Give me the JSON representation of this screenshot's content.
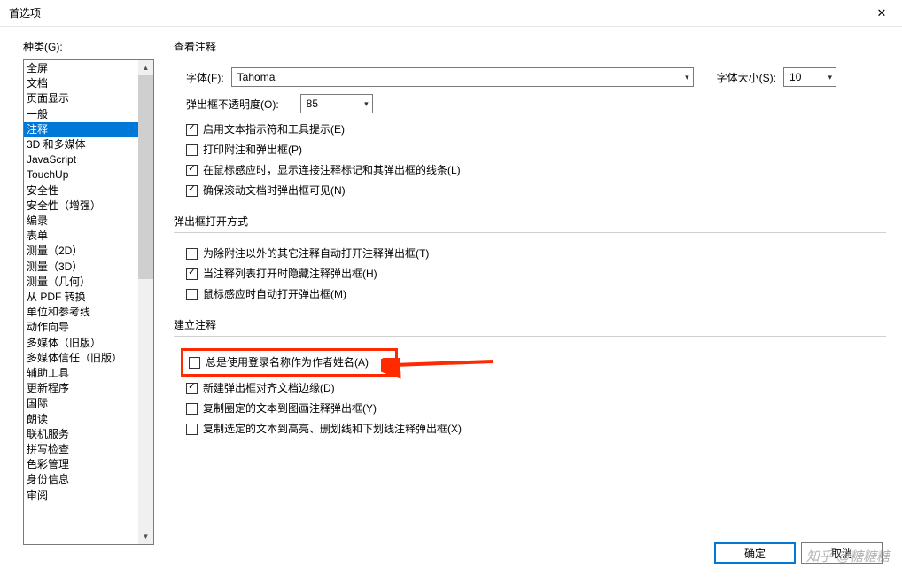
{
  "window": {
    "title": "首选项"
  },
  "leftLabel": "种类(G):",
  "categories": [
    "全屏",
    "文档",
    "页面显示",
    "一般",
    "注释",
    "",
    "3D 和多媒体",
    "JavaScript",
    "TouchUp",
    "安全性",
    "安全性（增强）",
    "编录",
    "表单",
    "测量（2D）",
    "测量（3D）",
    "测量（几何）",
    "从 PDF 转换",
    "单位和参考线",
    "动作向导",
    "多媒体（旧版）",
    "多媒体信任（旧版）",
    "辅助工具",
    "更新程序",
    "国际",
    "朗读",
    "联机服务",
    "拼写检查",
    "色彩管理",
    "身份信息",
    "审阅"
  ],
  "selectedIndex": 4,
  "group1": {
    "title": "查看注释",
    "fontLabel": "字体(F):",
    "fontValue": "Tahoma",
    "sizeLabel": "字体大小(S):",
    "sizeValue": "10",
    "opacityLabel": "弹出框不透明度(O):",
    "opacityValue": "85",
    "checks": [
      {
        "checked": true,
        "label": "启用文本指示符和工具提示(E)"
      },
      {
        "checked": false,
        "label": "打印附注和弹出框(P)"
      },
      {
        "checked": true,
        "label": "在鼠标感应时，显示连接注释标记和其弹出框的线条(L)"
      },
      {
        "checked": true,
        "label": "确保滚动文档时弹出框可见(N)"
      }
    ]
  },
  "group2": {
    "title": "弹出框打开方式",
    "checks": [
      {
        "checked": false,
        "label": "为除附注以外的其它注释自动打开注释弹出框(T)"
      },
      {
        "checked": true,
        "label": "当注释列表打开时隐藏注释弹出框(H)"
      },
      {
        "checked": false,
        "label": "鼠标感应时自动打开弹出框(M)"
      }
    ]
  },
  "group3": {
    "title": "建立注释",
    "checks": [
      {
        "checked": false,
        "label": "总是使用登录名称作为作者姓名(A)",
        "highlighted": true
      },
      {
        "checked": true,
        "label": "新建弹出框对齐文档边缘(D)"
      },
      {
        "checked": false,
        "label": "复制圈定的文本到图画注释弹出框(Y)"
      },
      {
        "checked": false,
        "label": "复制选定的文本到高亮、删划线和下划线注释弹出框(X)"
      }
    ]
  },
  "buttons": {
    "ok": "确定",
    "cancel": "取消"
  },
  "watermark": "知乎 @糖糖糖"
}
